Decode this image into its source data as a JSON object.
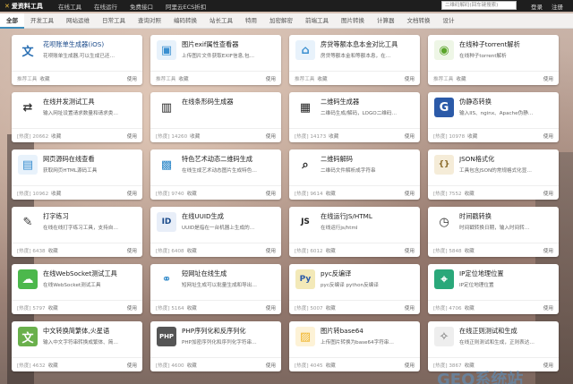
{
  "logo": "爱资料工具",
  "topnav": [
    "在线工具",
    "在线运行",
    "免费接口",
    "阿里云ECS折扣"
  ],
  "search_placeholder": "二维码解码(回车键搜索)",
  "top_links": [
    "登录",
    "注册"
  ],
  "categories": [
    "全部",
    "开发工具",
    "网站运维",
    "日常工具",
    "查询对照",
    "编码转换",
    "站长工具",
    "特用",
    "加密解密",
    "前端工具",
    "图片转换",
    "计算器",
    "文档转换",
    "设计"
  ],
  "cards": [
    {
      "icon": "文",
      "icon_name": "wen-text-icon",
      "color": "#2a6fb3",
      "bg": "#fff",
      "title": "花呗账单生成器(iOS)",
      "desc": "花呗账单生成器,可以生成已还…",
      "hot": "推荐工具",
      "fav": "收藏",
      "use": "使用",
      "title_color": "#1a4a8a"
    },
    {
      "icon": "▣",
      "icon_name": "image-exif-icon",
      "color": "#3a8fd0",
      "bg": "#e8f2fb",
      "title": "图片exif属性查看器",
      "desc": "上传图片文件获取EXIF信息,包…",
      "hot": "推荐工具",
      "fav": "收藏",
      "use": "使用",
      "title_color": "#222"
    },
    {
      "icon": "⌂",
      "icon_name": "house-icon",
      "color": "#3a8fd0",
      "bg": "#e8f2fb",
      "title": "房贷等额本息本金对比工具",
      "desc": "房贷等额本金和等额本息，在…",
      "hot": "推荐工具",
      "fav": "收藏",
      "use": "使用",
      "title_color": "#222"
    },
    {
      "icon": "◉",
      "icon_name": "torrent-icon",
      "color": "#5aa52a",
      "bg": "#eef6e6",
      "title": "在线种子torrent解析",
      "desc": "在线种子torrent解析",
      "hot": "推荐工具",
      "fav": "收藏",
      "use": "使用",
      "title_color": "#222"
    },
    {
      "icon": "⇄",
      "icon_name": "network-test-icon",
      "color": "#333",
      "bg": "#fff",
      "title": "在线并发测试工具",
      "desc": "输入网址设置请求数量和请求类…",
      "hot": "[热度] 20662",
      "fav": "收藏",
      "use": "使用",
      "title_color": "#222"
    },
    {
      "icon": "▥",
      "icon_name": "barcode-icon",
      "color": "#222",
      "bg": "#fff",
      "title": "在线条形码生成器",
      "desc": "",
      "hot": "[热度] 14260",
      "fav": "收藏",
      "use": "使用",
      "title_color": "#222"
    },
    {
      "icon": "▦",
      "icon_name": "qrcode-icon",
      "color": "#222",
      "bg": "#fff",
      "title": "二维码生成器",
      "desc": "二维码生成/解码，LOGO二维码…",
      "hot": "[热度] 14173",
      "fav": "收藏",
      "use": "使用",
      "title_color": "#222"
    },
    {
      "icon": "G",
      "icon_name": "pseudo-static-icon",
      "color": "#fff",
      "bg": "#2b5aa8",
      "title": "伪静态转换",
      "desc": "输入IIS、nginx、Apache伪静…",
      "hot": "[热度] 10978",
      "fav": "收藏",
      "use": "使用",
      "title_color": "#222"
    },
    {
      "icon": "▤",
      "icon_name": "webpage-source-icon",
      "color": "#3a8fd0",
      "bg": "#e8f2fb",
      "title": "网页源码在线查看",
      "desc": "获取网页HTML源码工具",
      "hot": "[热度] 10962",
      "fav": "收藏",
      "use": "使用",
      "title_color": "#222"
    },
    {
      "icon": "▩",
      "icon_name": "art-qrcode-icon",
      "color": "#2a86c8",
      "bg": "#fff",
      "title": "特色艺术动态二维码生成",
      "desc": "在线生成艺术动态图片生成特色…",
      "hot": "[热度] 9740",
      "fav": "收藏",
      "use": "使用",
      "title_color": "#222"
    },
    {
      "icon": "⌕",
      "icon_name": "qrcode-decode-icon",
      "color": "#222",
      "bg": "#fff",
      "title": "二维码解码",
      "desc": "二维码文件解析成字符串",
      "hot": "[热度] 9614",
      "fav": "收藏",
      "use": "使用",
      "title_color": "#222"
    },
    {
      "icon": "{}",
      "icon_name": "json-icon",
      "color": "#8a6a2a",
      "bg": "#f5ecd8",
      "title": "JSON格式化",
      "desc": "工具包含JSON的常规格式化显…",
      "hot": "[热度] 7552",
      "fav": "收藏",
      "use": "使用",
      "title_color": "#222"
    },
    {
      "icon": "✎",
      "icon_name": "typing-icon",
      "color": "#333",
      "bg": "#fff",
      "title": "打字练习",
      "desc": "在线在线打字练习工具，支持自…",
      "hot": "[热度] 6438",
      "fav": "收藏",
      "use": "使用",
      "title_color": "#222"
    },
    {
      "icon": "ID",
      "icon_name": "uuid-icon",
      "color": "#1a4a8a",
      "bg": "#e8eef8",
      "title": "在线UUID生成",
      "desc": "UUID是指在一台机器上生成的…",
      "hot": "[热度] 6408",
      "fav": "收藏",
      "use": "使用",
      "title_color": "#222"
    },
    {
      "icon": "JS",
      "icon_name": "javascript-icon",
      "color": "#222",
      "bg": "#fff",
      "title": "在线运行JS/HTML",
      "desc": "在线运行js/html",
      "hot": "[热度] 6012",
      "fav": "收藏",
      "use": "使用",
      "title_color": "#222"
    },
    {
      "icon": "◷",
      "icon_name": "clock-icon",
      "color": "#333",
      "bg": "#fff",
      "title": "时间戳转换",
      "desc": "时间戳转换日期，输入时间转…",
      "hot": "[热度] 5848",
      "fav": "收藏",
      "use": "使用",
      "title_color": "#222"
    },
    {
      "icon": "☁",
      "icon_name": "websocket-icon",
      "color": "#fff",
      "bg": "#4cb84c",
      "title": "在线WebSocket测试工具",
      "desc": "在线WebSocket测试工具",
      "hot": "[热度] 5797",
      "fav": "收藏",
      "use": "使用",
      "title_color": "#222"
    },
    {
      "icon": "⚭",
      "icon_name": "short-link-icon",
      "color": "#2a86c8",
      "bg": "#fff",
      "title": "短网址在线生成",
      "desc": "短网址生成可以批量生成和导出…",
      "hot": "[热度] 5164",
      "fav": "收藏",
      "use": "使用",
      "title_color": "#222"
    },
    {
      "icon": "Py",
      "icon_name": "python-icon",
      "color": "#2b5aa8",
      "bg": "#f3e9b8",
      "title": "pyc反编译",
      "desc": "pyc反编译 python反编译",
      "hot": "[热度] 5007",
      "fav": "收藏",
      "use": "使用",
      "title_color": "#222"
    },
    {
      "icon": "⌖",
      "icon_name": "ip-location-icon",
      "color": "#fff",
      "bg": "#2aa87a",
      "title": "IP定位地理位置",
      "desc": "IP定位地理位置",
      "hot": "[热度] 4706",
      "fav": "收藏",
      "use": "使用",
      "title_color": "#222"
    },
    {
      "icon": "文",
      "icon_name": "chinese-convert-icon",
      "color": "#fff",
      "bg": "#6ab04c",
      "title": "中文转换简繁体,火星语",
      "desc": "输入中文字符串转换成繁体、简…",
      "hot": "[热度] 4632",
      "fav": "收藏",
      "use": "使用",
      "title_color": "#222"
    },
    {
      "icon": "PHP",
      "icon_name": "php-icon",
      "color": "#fff",
      "bg": "#555",
      "title": "PHP序列化和反序列化",
      "desc": "PHP加密序列化和序列化字符串…",
      "hot": "[热度] 4600",
      "fav": "收藏",
      "use": "使用",
      "title_color": "#222"
    },
    {
      "icon": "▨",
      "icon_name": "image-base64-icon",
      "color": "#f0b428",
      "bg": "#fdf2d6",
      "title": "图片转base64",
      "desc": "上传图片转换为base64字符串…",
      "hot": "[热度] 4045",
      "fav": "收藏",
      "use": "使用",
      "title_color": "#222"
    },
    {
      "icon": "✧",
      "icon_name": "regex-icon",
      "color": "#666",
      "bg": "#eee",
      "title": "在线正则测试和生成",
      "desc": "在线正则测试和生成，正则表达…",
      "hot": "[热度] 3867",
      "fav": "收藏",
      "use": "使用",
      "title_color": "#222"
    }
  ],
  "watermark": "GEO系统站",
  "colors": {
    "topbar": "#1e1e1e",
    "accent": "#3c8dbc"
  }
}
